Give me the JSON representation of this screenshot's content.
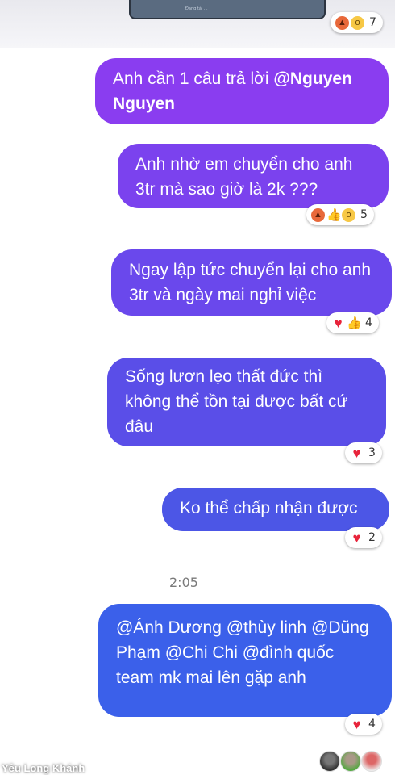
{
  "top": {
    "preview_text": "Đang tải ...",
    "reactions": {
      "icons": [
        "angry-icon",
        "wow-icon"
      ],
      "count": "7"
    }
  },
  "messages": [
    {
      "text": "Anh cần 1 câu trả lời ",
      "mention": "@Nguyen Nguyen",
      "color": "#8a3df0",
      "reactions": null
    },
    {
      "text": "Anh nhờ em chuyển cho anh 3tr mà sao giờ là 2k ???",
      "color": "#7b42ee",
      "reactions": {
        "icons": [
          "angry-icon",
          "like-icon",
          "wow-icon"
        ],
        "count": "5"
      }
    },
    {
      "text": "Ngay lập tức chuyển lại cho anh 3tr và ngày mai nghỉ việc",
      "color": "#6a48ec",
      "reactions": {
        "icons": [
          "heart-icon",
          "like-icon"
        ],
        "count": "4"
      }
    },
    {
      "text": "Sống lươn lẹo thất đức thì không thể tồn tại được bất cứ đâu",
      "color": "#5a4ee8",
      "reactions": {
        "icons": [
          "heart-icon"
        ],
        "count": "3"
      }
    },
    {
      "text": "Ko thể chấp nhận được",
      "color": "#4c56e6",
      "reactions": {
        "icons": [
          "heart-icon"
        ],
        "count": "2"
      }
    },
    {
      "text": "@Ánh Dương  @thùy linh @Dũng Phạm @Chi Chi @đình quốc  team mk  mai lên gặp anh",
      "color": "#3b60ea",
      "reactions": {
        "icons": [
          "heart-icon"
        ],
        "count": "4"
      }
    }
  ],
  "timestamp": "2:05",
  "watermark": "Yêu Long Khánh",
  "seen_by": [
    "avatar-1",
    "avatar-2",
    "avatar-3"
  ]
}
